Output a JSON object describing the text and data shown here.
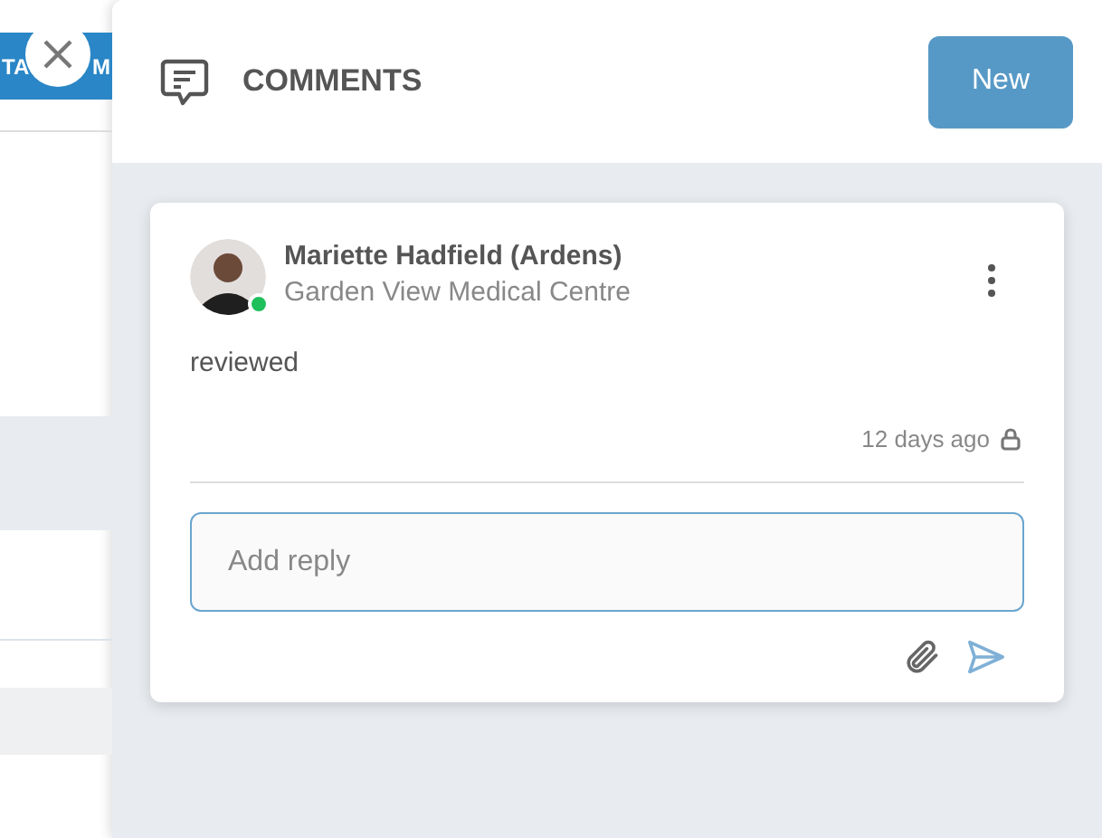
{
  "background_bar": {
    "fragments": [
      "TA",
      "M"
    ]
  },
  "panel": {
    "title": "COMMENTS",
    "new_button": "New"
  },
  "comments": [
    {
      "author": "Mariette Hadfield (Ardens)",
      "organisation": "Garden View Medical Centre",
      "online": true,
      "body": "reviewed",
      "time": "12 days ago",
      "private": true
    }
  ],
  "reply": {
    "placeholder": "Add reply"
  }
}
